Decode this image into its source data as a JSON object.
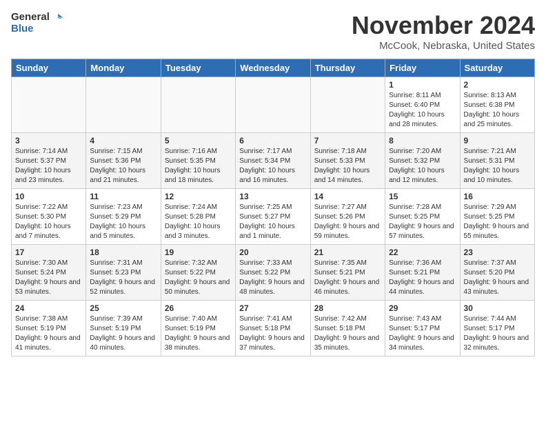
{
  "header": {
    "logo_line1": "General",
    "logo_line2": "Blue",
    "month_title": "November 2024",
    "location": "McCook, Nebraska, United States"
  },
  "weekdays": [
    "Sunday",
    "Monday",
    "Tuesday",
    "Wednesday",
    "Thursday",
    "Friday",
    "Saturday"
  ],
  "weeks": [
    [
      {
        "num": "",
        "info": ""
      },
      {
        "num": "",
        "info": ""
      },
      {
        "num": "",
        "info": ""
      },
      {
        "num": "",
        "info": ""
      },
      {
        "num": "",
        "info": ""
      },
      {
        "num": "1",
        "info": "Sunrise: 8:11 AM\nSunset: 6:40 PM\nDaylight: 10 hours and 28 minutes."
      },
      {
        "num": "2",
        "info": "Sunrise: 8:13 AM\nSunset: 6:38 PM\nDaylight: 10 hours and 25 minutes."
      }
    ],
    [
      {
        "num": "3",
        "info": "Sunrise: 7:14 AM\nSunset: 5:37 PM\nDaylight: 10 hours and 23 minutes."
      },
      {
        "num": "4",
        "info": "Sunrise: 7:15 AM\nSunset: 5:36 PM\nDaylight: 10 hours and 21 minutes."
      },
      {
        "num": "5",
        "info": "Sunrise: 7:16 AM\nSunset: 5:35 PM\nDaylight: 10 hours and 18 minutes."
      },
      {
        "num": "6",
        "info": "Sunrise: 7:17 AM\nSunset: 5:34 PM\nDaylight: 10 hours and 16 minutes."
      },
      {
        "num": "7",
        "info": "Sunrise: 7:18 AM\nSunset: 5:33 PM\nDaylight: 10 hours and 14 minutes."
      },
      {
        "num": "8",
        "info": "Sunrise: 7:20 AM\nSunset: 5:32 PM\nDaylight: 10 hours and 12 minutes."
      },
      {
        "num": "9",
        "info": "Sunrise: 7:21 AM\nSunset: 5:31 PM\nDaylight: 10 hours and 10 minutes."
      }
    ],
    [
      {
        "num": "10",
        "info": "Sunrise: 7:22 AM\nSunset: 5:30 PM\nDaylight: 10 hours and 7 minutes."
      },
      {
        "num": "11",
        "info": "Sunrise: 7:23 AM\nSunset: 5:29 PM\nDaylight: 10 hours and 5 minutes."
      },
      {
        "num": "12",
        "info": "Sunrise: 7:24 AM\nSunset: 5:28 PM\nDaylight: 10 hours and 3 minutes."
      },
      {
        "num": "13",
        "info": "Sunrise: 7:25 AM\nSunset: 5:27 PM\nDaylight: 10 hours and 1 minute."
      },
      {
        "num": "14",
        "info": "Sunrise: 7:27 AM\nSunset: 5:26 PM\nDaylight: 9 hours and 59 minutes."
      },
      {
        "num": "15",
        "info": "Sunrise: 7:28 AM\nSunset: 5:25 PM\nDaylight: 9 hours and 57 minutes."
      },
      {
        "num": "16",
        "info": "Sunrise: 7:29 AM\nSunset: 5:25 PM\nDaylight: 9 hours and 55 minutes."
      }
    ],
    [
      {
        "num": "17",
        "info": "Sunrise: 7:30 AM\nSunset: 5:24 PM\nDaylight: 9 hours and 53 minutes."
      },
      {
        "num": "18",
        "info": "Sunrise: 7:31 AM\nSunset: 5:23 PM\nDaylight: 9 hours and 52 minutes."
      },
      {
        "num": "19",
        "info": "Sunrise: 7:32 AM\nSunset: 5:22 PM\nDaylight: 9 hours and 50 minutes."
      },
      {
        "num": "20",
        "info": "Sunrise: 7:33 AM\nSunset: 5:22 PM\nDaylight: 9 hours and 48 minutes."
      },
      {
        "num": "21",
        "info": "Sunrise: 7:35 AM\nSunset: 5:21 PM\nDaylight: 9 hours and 46 minutes."
      },
      {
        "num": "22",
        "info": "Sunrise: 7:36 AM\nSunset: 5:21 PM\nDaylight: 9 hours and 44 minutes."
      },
      {
        "num": "23",
        "info": "Sunrise: 7:37 AM\nSunset: 5:20 PM\nDaylight: 9 hours and 43 minutes."
      }
    ],
    [
      {
        "num": "24",
        "info": "Sunrise: 7:38 AM\nSunset: 5:19 PM\nDaylight: 9 hours and 41 minutes."
      },
      {
        "num": "25",
        "info": "Sunrise: 7:39 AM\nSunset: 5:19 PM\nDaylight: 9 hours and 40 minutes."
      },
      {
        "num": "26",
        "info": "Sunrise: 7:40 AM\nSunset: 5:19 PM\nDaylight: 9 hours and 38 minutes."
      },
      {
        "num": "27",
        "info": "Sunrise: 7:41 AM\nSunset: 5:18 PM\nDaylight: 9 hours and 37 minutes."
      },
      {
        "num": "28",
        "info": "Sunrise: 7:42 AM\nSunset: 5:18 PM\nDaylight: 9 hours and 35 minutes."
      },
      {
        "num": "29",
        "info": "Sunrise: 7:43 AM\nSunset: 5:17 PM\nDaylight: 9 hours and 34 minutes."
      },
      {
        "num": "30",
        "info": "Sunrise: 7:44 AM\nSunset: 5:17 PM\nDaylight: 9 hours and 32 minutes."
      }
    ]
  ]
}
